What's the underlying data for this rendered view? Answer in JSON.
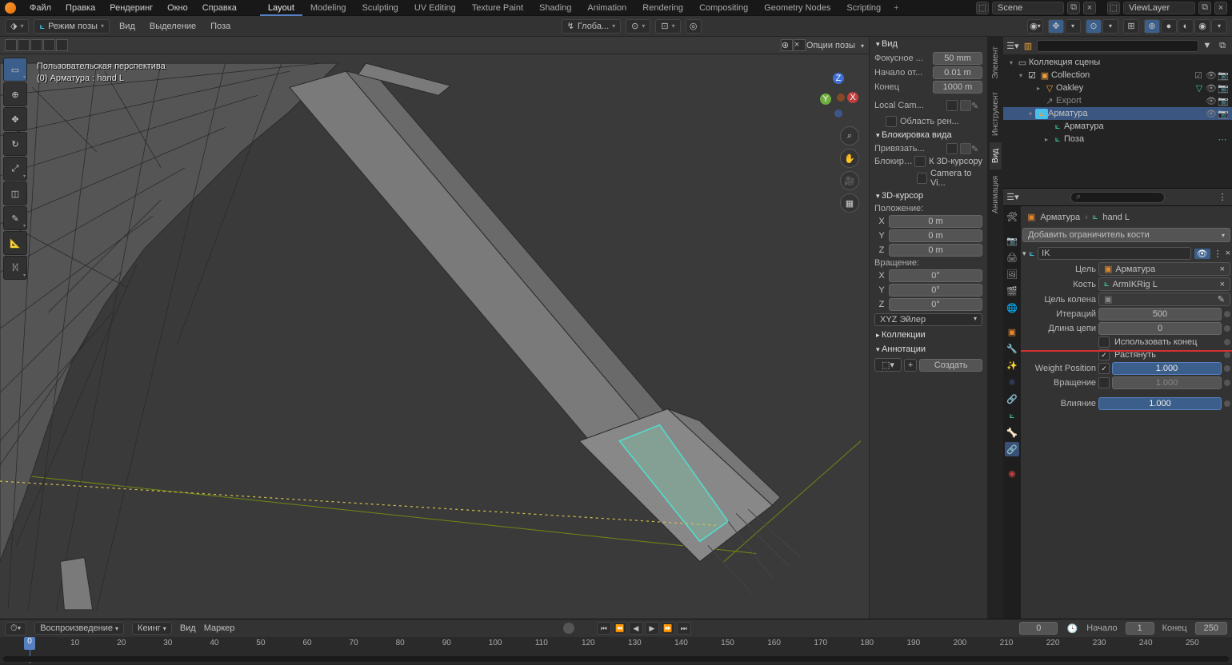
{
  "topmenu": {
    "file": "Файл",
    "edit": "Правка",
    "render": "Рендеринг",
    "window": "Окно",
    "help": "Справка"
  },
  "workspaces": [
    "Layout",
    "Modeling",
    "Sculpting",
    "UV Editing",
    "Texture Paint",
    "Shading",
    "Animation",
    "Rendering",
    "Compositing",
    "Geometry Nodes",
    "Scripting"
  ],
  "active_workspace": "Layout",
  "scene_label": "Scene",
  "viewlayer_label": "ViewLayer",
  "header2": {
    "mode": "Режим позы",
    "view": "Вид",
    "select": "Выделение",
    "pose": "Поза",
    "orient": "Глоба..."
  },
  "pose_options": "Опции позы",
  "overlay": {
    "l1": "Пользовательская перспектива",
    "l2": "(0) Арматура : hand L"
  },
  "tools": [
    "select",
    "cursor",
    "move",
    "rotate",
    "scale",
    "transform",
    "annotate",
    "measure",
    "extra"
  ],
  "npanel": {
    "view_section": "Вид",
    "focal_lbl": "Фокусное ...",
    "focal_val": "50 mm",
    "clip_start_lbl": "Начало от...",
    "clip_start_val": "0.01 m",
    "clip_end_lbl": "Конец",
    "clip_end_val": "1000 m",
    "local_cam": "Local Cam...",
    "render_region": "Область рен...",
    "view_lock": "Блокировка вида",
    "lock_to": "Привязать...",
    "lock_label": "Блокировка",
    "lock_3dcursor": "К 3D-курсору",
    "lock_camtoview": "Camera to Vi...",
    "cursor_section": "3D-курсор",
    "pos_label": "Положение:",
    "x": "X",
    "y": "Y",
    "z": "Z",
    "pos_x": "0 m",
    "pos_y": "0 m",
    "pos_z": "0 m",
    "rot_label": "Вращение:",
    "rot_x": "0°",
    "rot_y": "0°",
    "rot_z": "0°",
    "rot_mode": "XYZ Эйлер",
    "collections": "Коллекции",
    "annotations": "Аннотации",
    "create": "Создать"
  },
  "ntabs": [
    "Элемент",
    "Инструмент",
    "Вид",
    "Анимация"
  ],
  "ntab_active": "Вид",
  "outliner": {
    "scene_collection": "Коллекция сцены",
    "collection": "Collection",
    "oakley": "Oakley",
    "export": "Export",
    "armature": "Арматура",
    "armature_data": "Арматура",
    "pose": "Поза"
  },
  "props_crumb": {
    "a": "Арматура",
    "b": "hand L"
  },
  "add_constraint": "Добавить ограничитель кости",
  "constraint_name": "IK",
  "props": {
    "target_lbl": "Цель",
    "target_val": "Арматура",
    "bone_lbl": "Кость",
    "bone_val": "ArmIKRig L",
    "poletarget_lbl": "Цель колена",
    "iterations_lbl": "Итераций",
    "iterations_val": "500",
    "chainlen_lbl": "Длина цепи",
    "chainlen_val": "0",
    "use_tail": "Использовать конец",
    "stretch": "Растянуть",
    "weight_pos_lbl": "Weight Position",
    "weight_pos_val": "1.000",
    "rotation_lbl": "Вращение",
    "rotation_val": "1.000",
    "influence_lbl": "Влияние",
    "influence_val": "1.000"
  },
  "timeline": {
    "playback": "Воспроизведение",
    "keying": "Кеинг",
    "view": "Вид",
    "marker": "Маркер",
    "curframe": "0",
    "start_lbl": "Начало",
    "start": "1",
    "end_lbl": "Конец",
    "end": "250",
    "ticks": [
      "0",
      "10",
      "20",
      "30",
      "40",
      "50",
      "60",
      "70",
      "80",
      "90",
      "100",
      "110",
      "120",
      "130",
      "140",
      "150",
      "160",
      "170",
      "180",
      "190",
      "200",
      "210",
      "220",
      "230",
      "240",
      "250"
    ]
  }
}
